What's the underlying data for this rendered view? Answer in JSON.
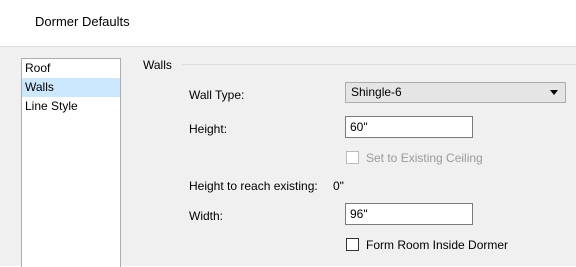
{
  "dialog": {
    "title": "Dormer Defaults"
  },
  "sidebar": {
    "items": [
      {
        "label": "Roof"
      },
      {
        "label": "Walls"
      },
      {
        "label": "Line Style"
      }
    ],
    "selected": "Walls"
  },
  "walls_group": {
    "title": "Walls",
    "wall_type": {
      "label": "Wall Type:",
      "value": "Shingle-6"
    },
    "height": {
      "label": "Height:",
      "value": "60\""
    },
    "set_to_existing_ceiling": {
      "label": "Set to Existing Ceiling",
      "checked": false,
      "enabled": false
    },
    "height_to_reach_existing": {
      "label": "Height to reach existing:",
      "value": "0\""
    },
    "width": {
      "label": "Width:",
      "value": "96\""
    },
    "form_room_inside_dormer": {
      "label": "Form Room Inside Dormer",
      "checked": false
    }
  },
  "colors": {
    "selection": "#cce8ff",
    "panel": "#f0f0f0",
    "disabled_text": "#9a9a9a"
  }
}
